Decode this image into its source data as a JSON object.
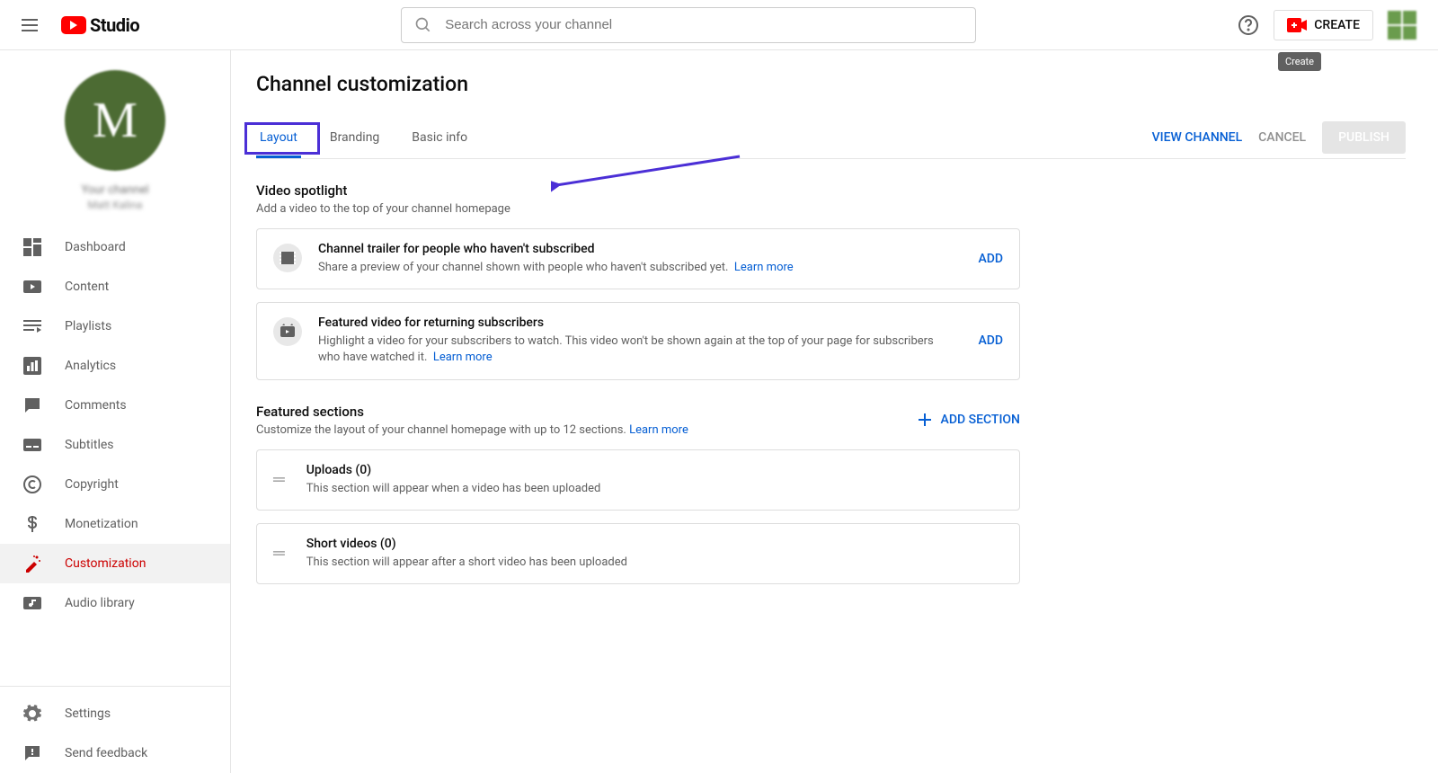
{
  "header": {
    "logo_text": "Studio",
    "search_placeholder": "Search across your channel",
    "create_label": "CREATE",
    "tooltip": "Create"
  },
  "sidebar": {
    "channel_avatar_letter": "M",
    "channel_label": "Your channel",
    "channel_sub": "Matt Kalina",
    "items": [
      {
        "label": "Dashboard"
      },
      {
        "label": "Content"
      },
      {
        "label": "Playlists"
      },
      {
        "label": "Analytics"
      },
      {
        "label": "Comments"
      },
      {
        "label": "Subtitles"
      },
      {
        "label": "Copyright"
      },
      {
        "label": "Monetization"
      },
      {
        "label": "Customization"
      },
      {
        "label": "Audio library"
      }
    ],
    "bottom": [
      {
        "label": "Settings"
      },
      {
        "label": "Send feedback"
      }
    ]
  },
  "main": {
    "page_title": "Channel customization",
    "tabs": [
      {
        "label": "Layout",
        "active": true
      },
      {
        "label": "Branding"
      },
      {
        "label": "Basic info"
      }
    ],
    "actions": {
      "view_channel": "VIEW CHANNEL",
      "cancel": "CANCEL",
      "publish": "PUBLISH"
    },
    "spotlight": {
      "title": "Video spotlight",
      "sub": "Add a video to the top of your channel homepage",
      "cards": [
        {
          "title": "Channel trailer for people who haven't subscribed",
          "sub": "Share a preview of your channel shown with people who haven't subscribed yet.",
          "learn": "Learn more",
          "action": "ADD"
        },
        {
          "title": "Featured video for returning subscribers",
          "sub": "Highlight a video for your subscribers to watch. This video won't be shown again at the top of your page for subscribers who have watched it.",
          "learn": "Learn more",
          "action": "ADD"
        }
      ]
    },
    "featured": {
      "title": "Featured sections",
      "sub": "Customize the layout of your channel homepage with up to 12 sections.",
      "learn": "Learn more",
      "add_section": "ADD SECTION",
      "cards": [
        {
          "title": "Uploads (0)",
          "sub": "This section will appear when a video has been uploaded"
        },
        {
          "title": "Short videos (0)",
          "sub": "This section will appear after a short video has been uploaded"
        }
      ]
    }
  }
}
